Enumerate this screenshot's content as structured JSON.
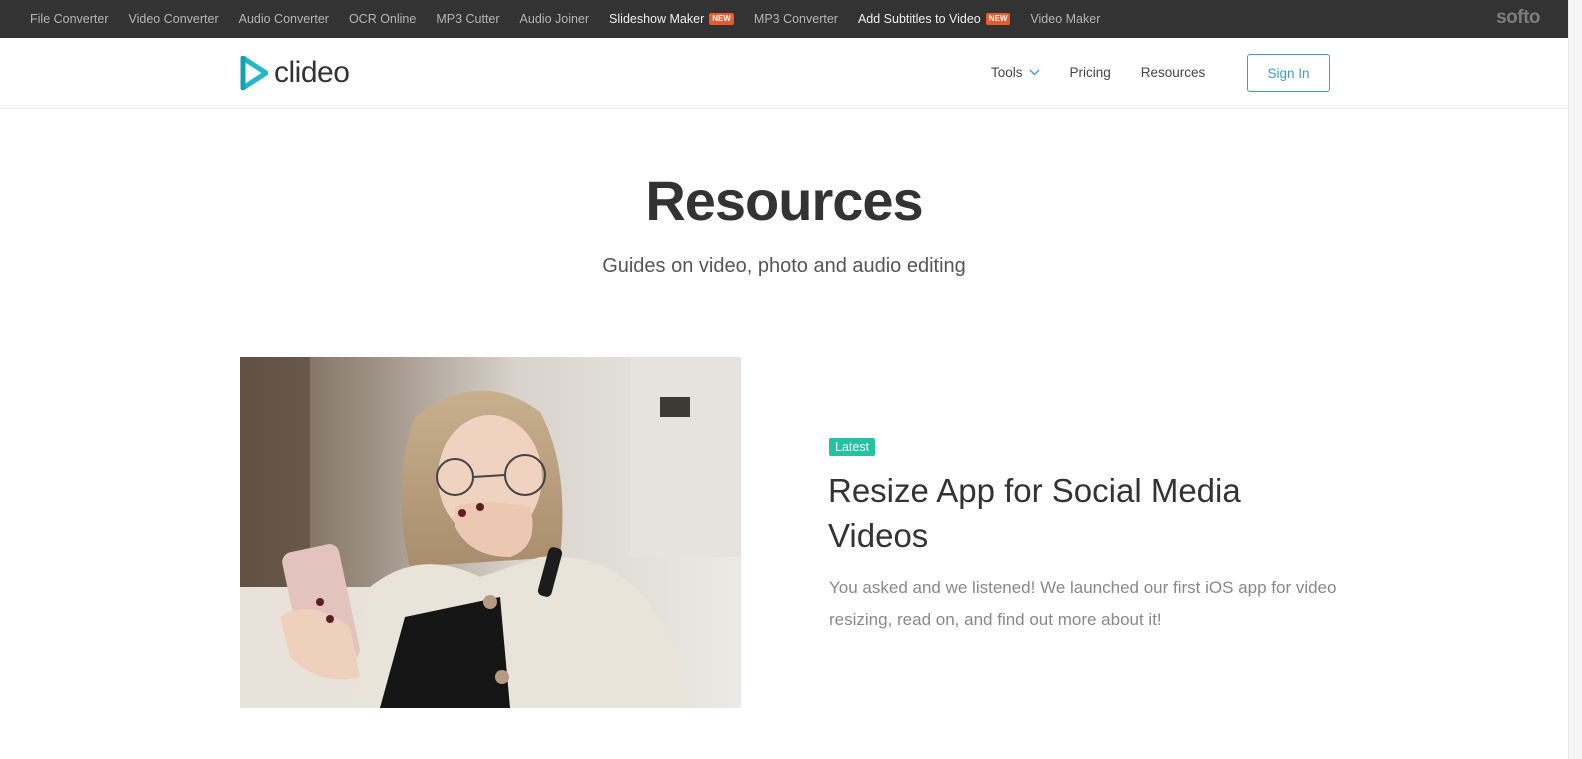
{
  "topbar": {
    "links": [
      {
        "label": "File Converter"
      },
      {
        "label": "Video Converter"
      },
      {
        "label": "Audio Converter"
      },
      {
        "label": "OCR Online"
      },
      {
        "label": "MP3 Cutter"
      },
      {
        "label": "Audio Joiner"
      },
      {
        "label": "Slideshow Maker",
        "badge": "NEW"
      },
      {
        "label": "MP3 Converter"
      },
      {
        "label": "Add Subtitles to Video",
        "badge": "NEW"
      },
      {
        "label": "Video Maker"
      }
    ],
    "brand": "softo"
  },
  "header": {
    "logo_text": "clideo",
    "nav": {
      "tools": "Tools",
      "pricing": "Pricing",
      "resources": "Resources"
    },
    "sign_in": "Sign In"
  },
  "hero": {
    "title": "Resources",
    "subtitle": "Guides on video, photo and audio editing"
  },
  "article": {
    "tag": "Latest",
    "title": "Resize App for Social Media Videos",
    "description": "You asked and we listened! We launched our first iOS app for video resizing, read on, and find out more about it!"
  },
  "colors": {
    "topbar_bg": "#333333",
    "accent_blue": "#3a9ad9",
    "badge_orange": "#ec5a2b",
    "tag_green": "#22c3a0",
    "logo_teal": "#1fb8c4"
  }
}
